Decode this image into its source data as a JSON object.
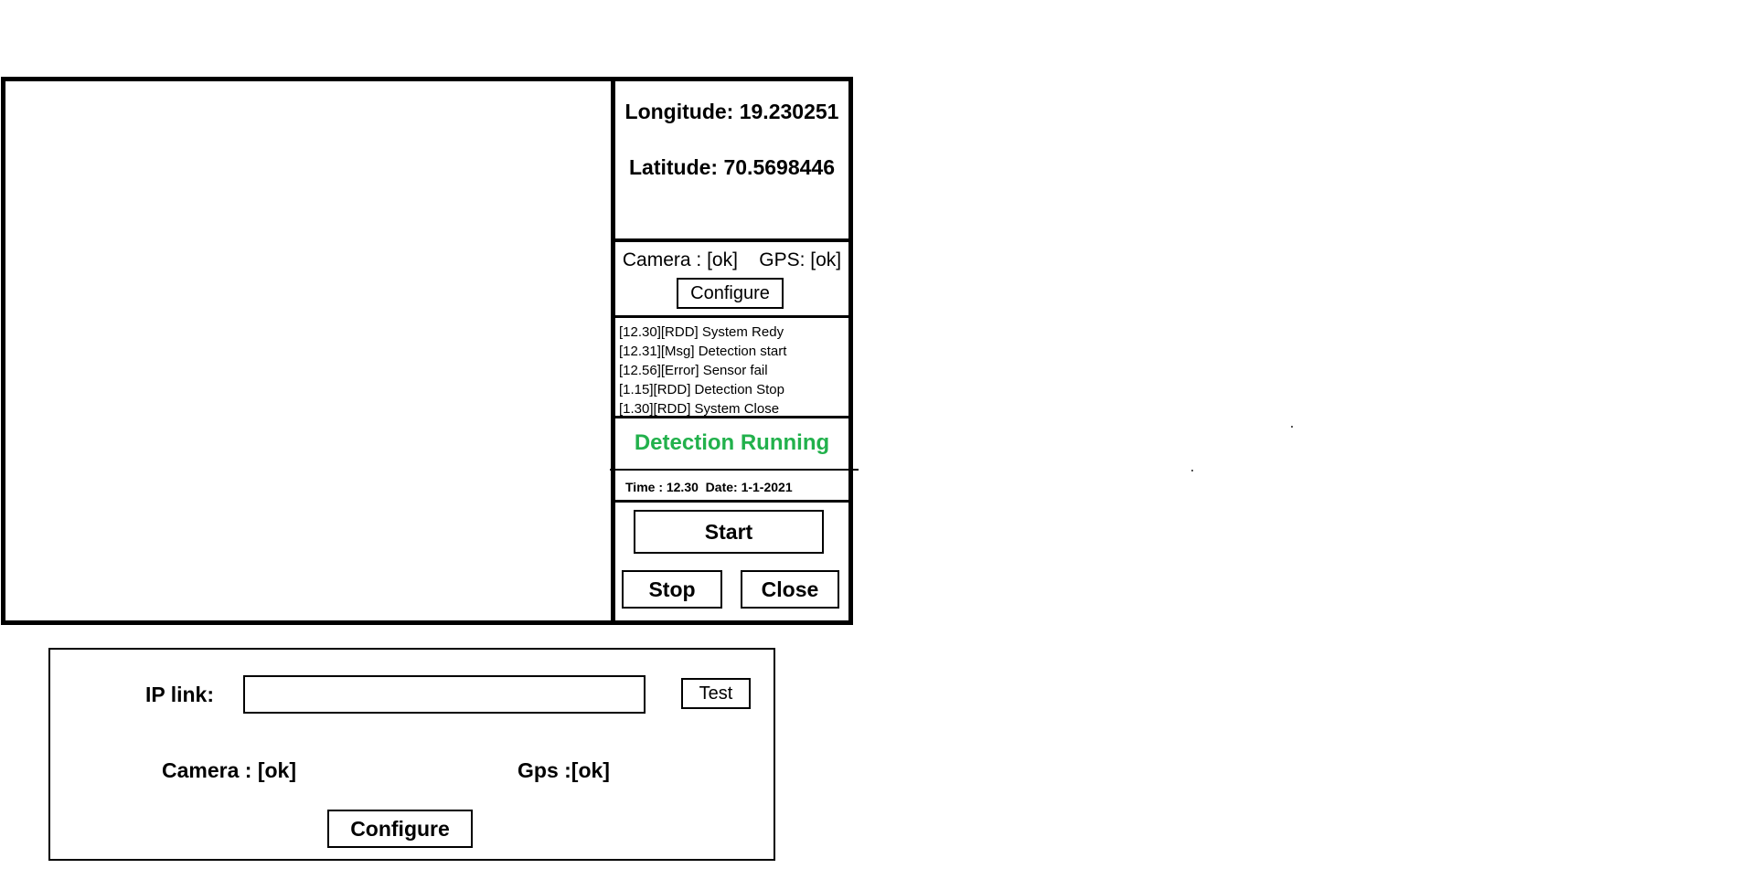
{
  "coordinates": {
    "longitude_label": "Longitude: 19.230251",
    "latitude_label": "Latitude: 70.5698446"
  },
  "status": {
    "text": "Camera : [ok]    GPS: [ok]",
    "configure_label": "Configure"
  },
  "log": {
    "entries": [
      "[12.30][RDD] System Redy",
      "[12.31][Msg] Detection start",
      "[12.56][Error] Sensor fail",
      "[1.15][RDD] Detection Stop",
      "[1.30][RDD] System Close"
    ]
  },
  "detection": {
    "status_text": "Detection Running",
    "status_color": "#22b14c"
  },
  "clock": {
    "text": "Time : 12.30  Date: 1-1-2021"
  },
  "controls": {
    "start_label": "Start",
    "stop_label": "Stop",
    "close_label": "Close"
  },
  "config_window": {
    "ip_label": "IP link:",
    "ip_value": "",
    "test_label": "Test",
    "camera_status": "Camera : [ok]",
    "gps_status": "Gps :[ok]",
    "configure_label": "Configure"
  }
}
